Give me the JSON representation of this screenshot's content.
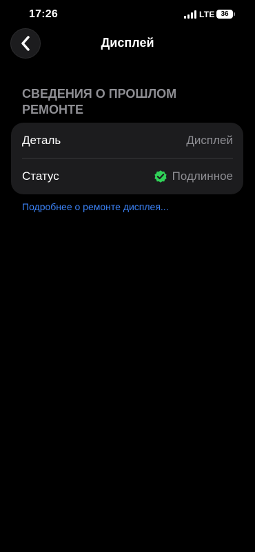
{
  "status_bar": {
    "time": "17:26",
    "network": "LTE",
    "battery": "36"
  },
  "nav": {
    "title": "Дисплей",
    "back_icon": "chevron-left-icon"
  },
  "section": {
    "header": "СВЕДЕНИЯ О ПРОШЛОМ РЕМОНТЕ",
    "rows": [
      {
        "label": "Деталь",
        "value": "Дисплей"
      },
      {
        "label": "Статус",
        "value": "Подлинное",
        "icon": "verified-checkmark-icon"
      }
    ]
  },
  "link": {
    "text": "Подробнее о ремонте дисплея..."
  },
  "colors": {
    "background": "#000000",
    "card": "#1c1c1e",
    "secondary_text": "#8e8e93",
    "link": "#3b82f6",
    "verified": "#30d158"
  }
}
